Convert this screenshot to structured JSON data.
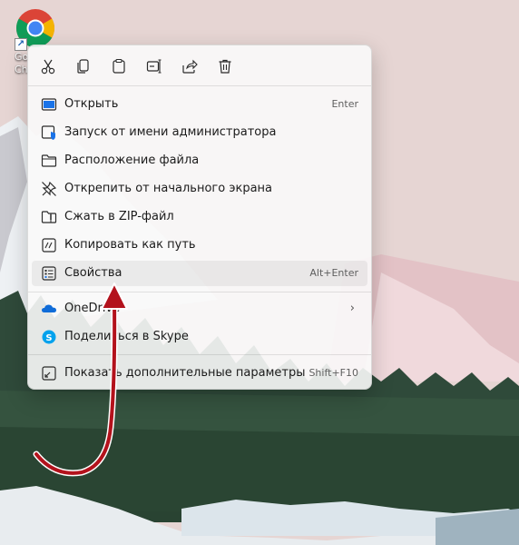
{
  "desktop": {
    "shortcut": {
      "label": "Go\nCh",
      "icon": "chrome-icon",
      "overlay_icon": "shortcut-arrow-icon"
    }
  },
  "context_menu": {
    "toolbar": [
      {
        "name": "cut",
        "icon": "scissors-icon"
      },
      {
        "name": "copy",
        "icon": "copy-icon"
      },
      {
        "name": "paste",
        "icon": "clipboard-icon"
      },
      {
        "name": "rename",
        "icon": "rename-icon"
      },
      {
        "name": "share",
        "icon": "share-icon"
      },
      {
        "name": "delete",
        "icon": "trash-icon"
      }
    ],
    "items": [
      {
        "label": "Открыть",
        "shortcut": "Enter",
        "icon": "open-app-icon"
      },
      {
        "label": "Запуск от имени администратора",
        "shortcut": "",
        "icon": "admin-shield-icon"
      },
      {
        "label": "Расположение файла",
        "shortcut": "",
        "icon": "folder-icon"
      },
      {
        "label": "Открепить от начального экрана",
        "shortcut": "",
        "icon": "unpin-icon"
      },
      {
        "label": "Сжать в ZIP-файл",
        "shortcut": "",
        "icon": "zip-folder-icon"
      },
      {
        "label": "Копировать как путь",
        "shortcut": "",
        "icon": "copy-path-icon"
      },
      {
        "label": "Свойства",
        "shortcut": "Alt+Enter",
        "icon": "properties-icon",
        "highlighted": true
      },
      {
        "label": "OneDrive",
        "shortcut": "",
        "icon": "onedrive-cloud-icon",
        "submenu": true
      },
      {
        "label": "Поделиться в Skype",
        "shortcut": "",
        "icon": "skype-icon"
      },
      {
        "label": "Показать дополнительные параметры",
        "shortcut": "Shift+F10",
        "icon": "more-options-icon"
      }
    ],
    "chevron": "›"
  },
  "annotation": {
    "color": "#b3121c",
    "icon": "red-curved-arrow-annotation"
  }
}
